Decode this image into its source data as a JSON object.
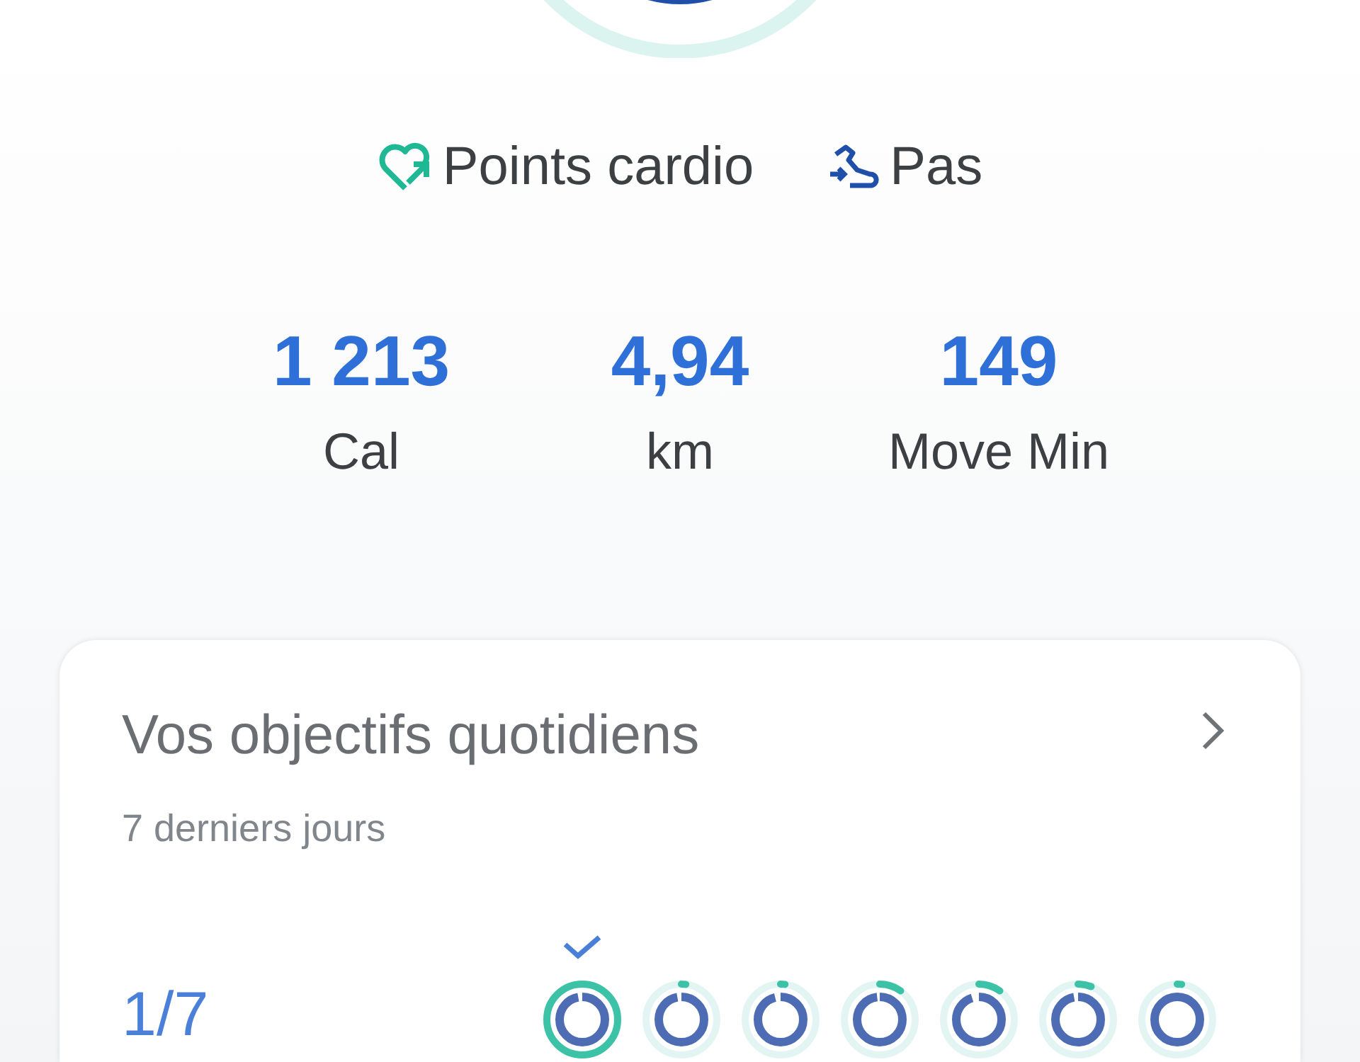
{
  "legend": [
    {
      "kind": "cardio",
      "label": "Points cardio"
    },
    {
      "kind": "steps",
      "label": "Pas"
    }
  ],
  "stats": [
    {
      "value": "1 213",
      "label": "Cal"
    },
    {
      "value": "4,94",
      "label": "km"
    },
    {
      "value": "149",
      "label": "Move Min"
    }
  ],
  "goals_card": {
    "title": "Vos objectifs quotidiens",
    "subtitle": "7 derniers jours",
    "score": "1/7",
    "days": [
      {
        "goal_met": true,
        "cardio": {
          "level": 1
        },
        "steps": {
          "level": 0.97
        }
      },
      {
        "goal_met": false,
        "cardio": {
          "level": 0.02
        },
        "steps": {
          "level": 0.97
        }
      },
      {
        "goal_met": false,
        "cardio": {
          "level": 0.02
        },
        "steps": {
          "level": 0.96
        }
      },
      {
        "goal_met": false,
        "cardio": {
          "level": 0.1
        },
        "steps": {
          "level": 0.98
        }
      },
      {
        "goal_met": false,
        "cardio": {
          "level": 0.1
        },
        "steps": {
          "level": 0.95
        }
      },
      {
        "goal_met": false,
        "cardio": {
          "level": 0.06
        },
        "steps": {
          "level": 0.97
        }
      },
      {
        "goal_met": false,
        "cardio": {
          "level": 0.02
        },
        "steps": {
          "level": 1
        }
      }
    ]
  }
}
